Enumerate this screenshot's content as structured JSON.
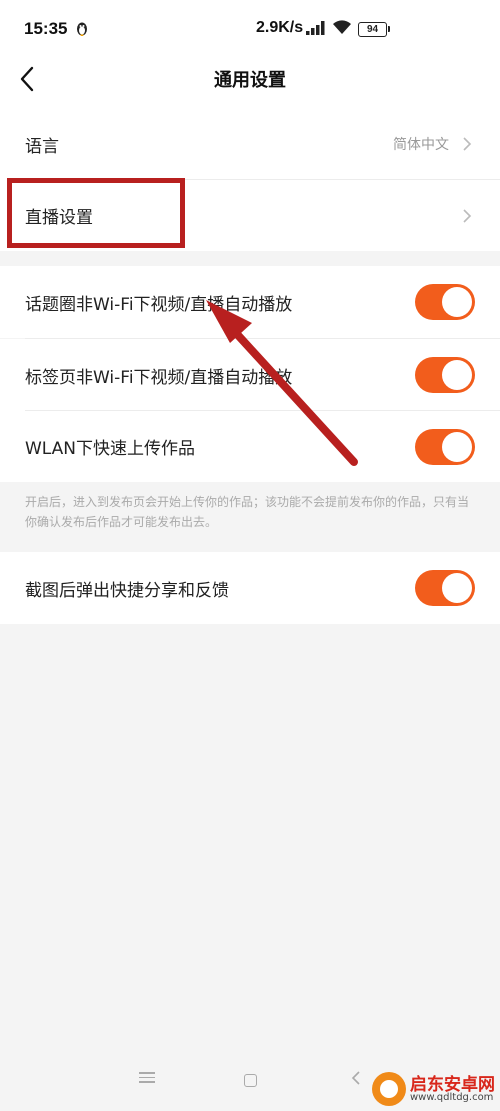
{
  "status_bar": {
    "time": "15:35",
    "network_speed": "2.9K/s",
    "battery": "94",
    "icons": [
      "penguin-icon",
      "signal-icon",
      "wifi-icon",
      "battery-icon"
    ]
  },
  "header": {
    "title": "通用设置",
    "back_icon": "chevron-left-icon"
  },
  "settings": {
    "language": {
      "label": "语言",
      "value": "简体中文"
    },
    "live": {
      "label": "直播设置"
    }
  },
  "toggles": [
    {
      "label": "话题圈非Wi-Fi下视频/直播自动播放",
      "on": true
    },
    {
      "label": "标签页非Wi-Fi下视频/直播自动播放",
      "on": true
    },
    {
      "label": "WLAN下快速上传作品",
      "on": true
    },
    {
      "label": "截图后弹出快捷分享和反馈",
      "on": true
    }
  ],
  "upload_hint": "开启后，进入到发布页会开始上传你的作品；该功能不会提前发布你的作品，只有当你确认发布后作品才可能发布出去。",
  "annotation": {
    "box_color": "#b8201f",
    "arrow_color": "#b8201f"
  },
  "accent_color": "#f25d1c",
  "watermark": {
    "title": "启东安卓网",
    "url": "www.qdltdg.com"
  }
}
